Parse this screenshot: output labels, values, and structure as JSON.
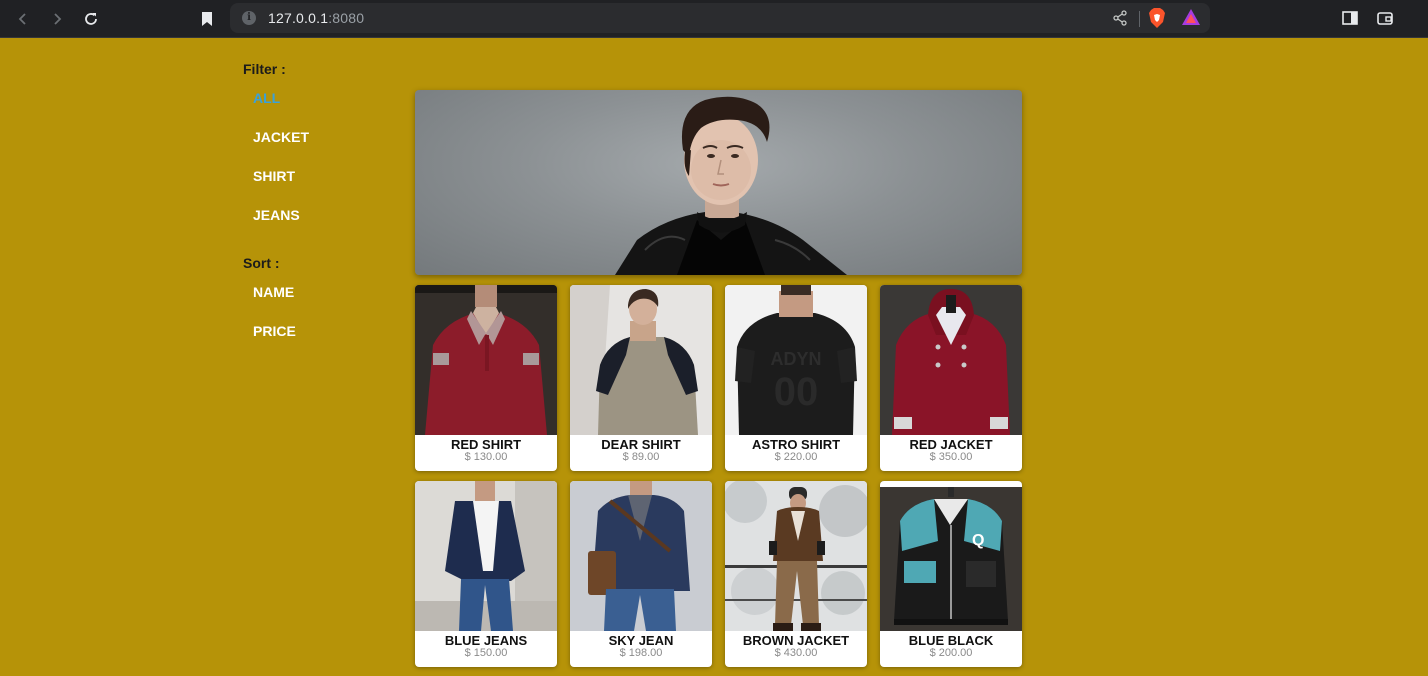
{
  "browser": {
    "url_host": "127.0.0.1",
    "url_port": ":8080"
  },
  "sidebar": {
    "filter_heading": "Filter :",
    "filters": [
      "ALL",
      "JACKET",
      "SHIRT",
      "JEANS"
    ],
    "active_filter": "ALL",
    "sort_heading": "Sort :",
    "sorts": [
      "NAME",
      "PRICE"
    ]
  },
  "products": [
    {
      "name": "RED SHIRT",
      "price": "$ 130.00"
    },
    {
      "name": "DEAR SHIRT",
      "price": "$ 89.00"
    },
    {
      "name": "ASTRO SHIRT",
      "price": "$ 220.00"
    },
    {
      "name": "RED JACKET",
      "price": "$ 350.00"
    },
    {
      "name": "BLUE JEANS",
      "price": "$ 150.00"
    },
    {
      "name": "SKY JEAN",
      "price": "$ 198.00"
    },
    {
      "name": "BROWN JACKET",
      "price": "$ 430.00"
    },
    {
      "name": "BLUE BLACK",
      "price": "$ 200.00"
    }
  ],
  "colors": {
    "page_background": "#b69308",
    "active_link": "#3aa1d9",
    "chrome_background": "#202124"
  }
}
